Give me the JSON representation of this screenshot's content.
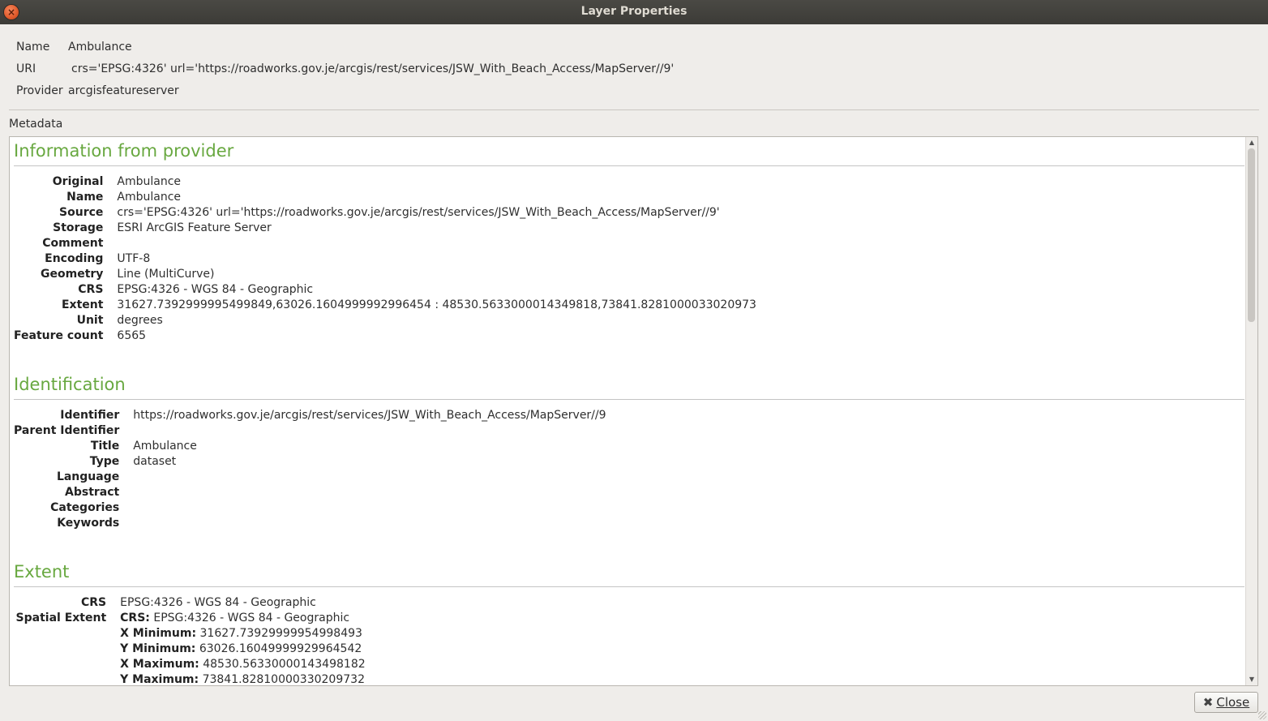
{
  "window": {
    "title": "Layer Properties"
  },
  "props": {
    "name_label": "Name",
    "name_value": "Ambulance",
    "uri_label": "URI",
    "uri_value": "crs='EPSG:4326' url='https://roadworks.gov.je/arcgis/rest/services/JSW_With_Beach_Access/MapServer//9'",
    "provider_label": "Provider",
    "provider_value": "arcgisfeatureserver"
  },
  "metadata_label": "Metadata",
  "info": {
    "heading": "Information from provider",
    "rows": [
      {
        "k": "Original",
        "v": "Ambulance"
      },
      {
        "k": "Name",
        "v": "Ambulance"
      },
      {
        "k": "Source",
        "v": "crs='EPSG:4326' url='https://roadworks.gov.je/arcgis/rest/services/JSW_With_Beach_Access/MapServer//9'"
      },
      {
        "k": "Storage",
        "v": "ESRI ArcGIS Feature Server"
      },
      {
        "k": "Comment",
        "v": ""
      },
      {
        "k": "Encoding",
        "v": "UTF-8"
      },
      {
        "k": "Geometry",
        "v": "Line (MultiCurve)"
      },
      {
        "k": "CRS",
        "v": "EPSG:4326 - WGS 84 - Geographic"
      },
      {
        "k": "Extent",
        "v": "31627.7392999995499849,63026.1604999992996454 : 48530.5633000014349818,73841.8281000033020973"
      },
      {
        "k": "Unit",
        "v": "degrees"
      },
      {
        "k": "Feature count",
        "v": "6565"
      }
    ]
  },
  "identification": {
    "heading": "Identification",
    "rows": [
      {
        "k": "Identifier",
        "v": "https://roadworks.gov.je/arcgis/rest/services/JSW_With_Beach_Access/MapServer//9"
      },
      {
        "k": "Parent Identifier",
        "v": ""
      },
      {
        "k": "Title",
        "v": "Ambulance"
      },
      {
        "k": "Type",
        "v": "dataset"
      },
      {
        "k": "Language",
        "v": ""
      },
      {
        "k": "Abstract",
        "v": ""
      },
      {
        "k": "Categories",
        "v": ""
      },
      {
        "k": "Keywords",
        "v": ""
      }
    ]
  },
  "extent": {
    "heading": "Extent",
    "crs_label": "CRS",
    "crs_value": "EPSG:4326 - WGS 84 - Geographic",
    "spatial_label": "Spatial Extent",
    "spatial": [
      {
        "k": "CRS:",
        "v": "EPSG:4326 - WGS 84 - Geographic"
      },
      {
        "k": "X Minimum:",
        "v": "31627.73929999954998493"
      },
      {
        "k": "Y Minimum:",
        "v": "63026.16049999929964542"
      },
      {
        "k": "X Maximum:",
        "v": "48530.56330000143498182"
      },
      {
        "k": "Y Maximum:",
        "v": "73841.82810000330209732"
      }
    ]
  },
  "buttons": {
    "close_label": "Close",
    "close_icon": "close-x-icon"
  }
}
